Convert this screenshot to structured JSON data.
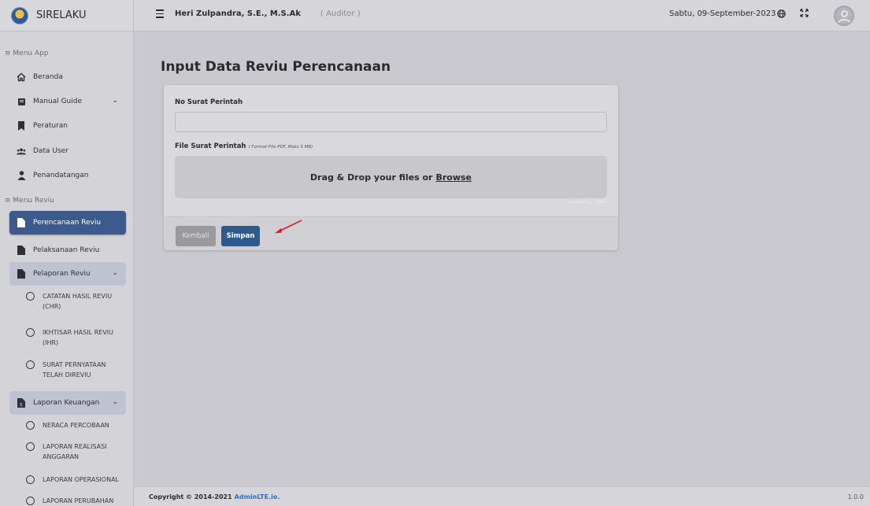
{
  "brand": {
    "name": "SIRELAKU"
  },
  "navbar": {
    "user_name": "Heri Zulpandra, S.E., M.S.Ak",
    "user_role": "( Auditor )",
    "date": "Sabtu, 09-September-2023"
  },
  "sidebar": {
    "header_app": "≡ Menu App",
    "header_reviu": "≡ Menu Reviu",
    "items": [
      {
        "label": "Beranda",
        "icon": "home-icon"
      },
      {
        "label": "Manual Guide",
        "icon": "book-icon"
      },
      {
        "label": "Peraturan",
        "icon": "bookmark-icon"
      },
      {
        "label": "Data User",
        "icon": "users-icon"
      },
      {
        "label": "Penandatangan",
        "icon": "user-icon"
      },
      {
        "label": "Perencanaan Reviu",
        "icon": "file-icon"
      },
      {
        "label": "Pelaksanaan Reviu",
        "icon": "file-icon"
      },
      {
        "label": "Pelaporan Reviu",
        "icon": "file-icon"
      },
      {
        "label": "Laporan Keuangan",
        "icon": "file-invoice-icon"
      }
    ],
    "pelaporan_sub": [
      {
        "line1": "CATATAN HASIL REVIU",
        "line2": "(CHR)"
      },
      {
        "line1": "IKHTISAR HASIL REVIU",
        "line2": "(IHR)"
      },
      {
        "line1": "SURAT PERNYATAAN",
        "line2": "TELAH DIREVIU"
      }
    ],
    "keuangan_sub": [
      {
        "line1": "NERACA PERCOBAAN",
        "line2": ""
      },
      {
        "line1": "LAPORAN REALISASI",
        "line2": "ANGGARAN"
      },
      {
        "line1": "LAPORAN OPERASIONAL",
        "line2": ""
      },
      {
        "line1": "LAPORAN PERUBAHAN",
        "line2": ""
      }
    ]
  },
  "main": {
    "title": "Input Data Reviu Perencanaan",
    "no_surat_label": "No Surat Perintah",
    "no_surat_value": "",
    "file_label": "File Surat Perintah",
    "file_hint": "( Format File PDF, Maks 5 MB)",
    "dropzone_text": "Drag & Drop your files or",
    "dropzone_browse": "Browse",
    "powered_by": "Powered by PQINA",
    "back_label": "Kembali",
    "save_label": "Simpan"
  },
  "footer": {
    "copyright": "Copyright © 2014-2021",
    "link": "AdminLTE.io.",
    "version": "1.0.0"
  },
  "colors": {
    "active_nav": "#3d5a8c",
    "save_button": "#2e5a8e",
    "back_button": "#9a9a9e",
    "arrow": "#e8141e",
    "link": "#2f6fc4"
  }
}
